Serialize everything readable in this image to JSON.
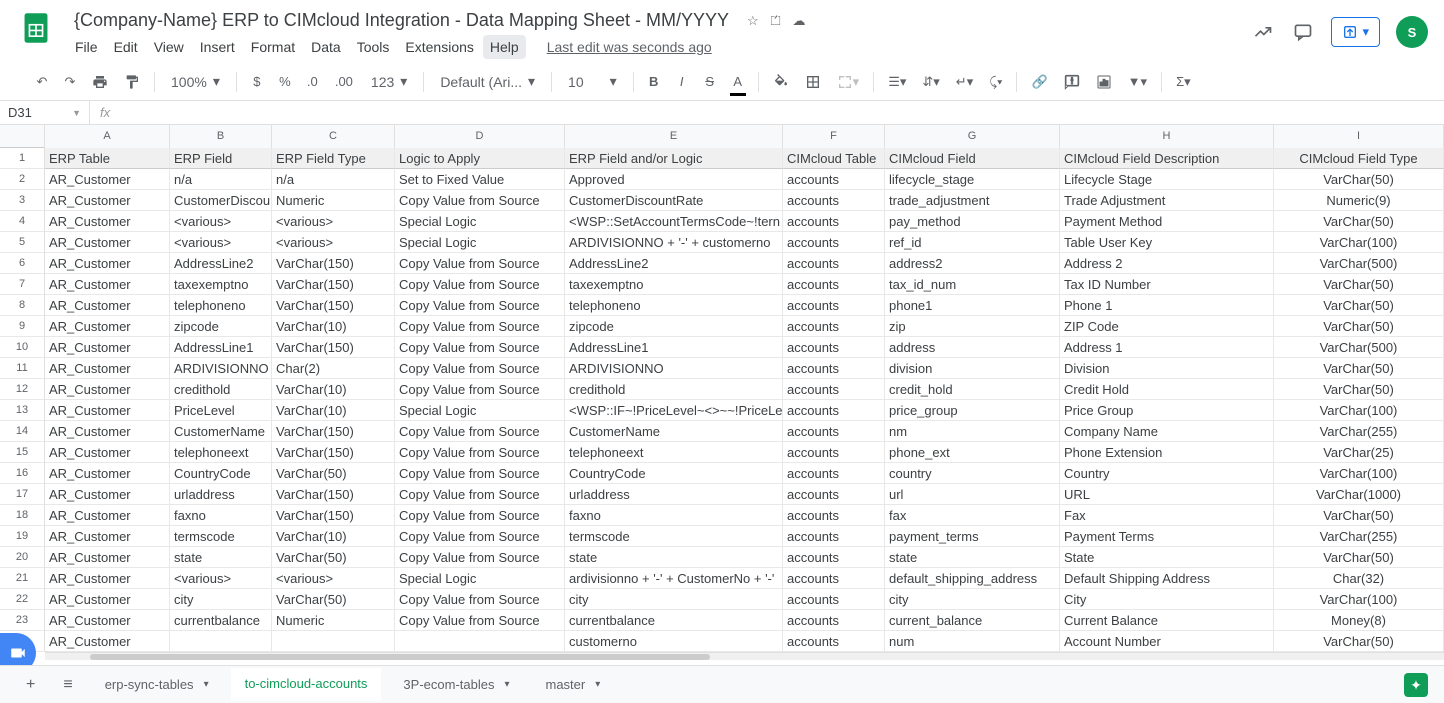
{
  "doc": {
    "title": "{Company-Name} ERP to CIMcloud Integration - Data Mapping Sheet - MM/YYYY",
    "last_edit": "Last edit was seconds ago"
  },
  "menu": {
    "file": "File",
    "edit": "Edit",
    "view": "View",
    "insert": "Insert",
    "format": "Format",
    "data": "Data",
    "tools": "Tools",
    "extensions": "Extensions",
    "help": "Help"
  },
  "toolbar": {
    "zoom": "100%",
    "font": "Default (Ari...",
    "size": "10",
    "more_formats": "123"
  },
  "namebox": "D31",
  "avatar_initial": "S",
  "columns": [
    "A",
    "B",
    "C",
    "D",
    "E",
    "F",
    "G",
    "H",
    "I"
  ],
  "col_widths": [
    "c-A",
    "c-B",
    "c-C",
    "c-D",
    "c-E",
    "c-F",
    "c-G",
    "c-H",
    "c-I"
  ],
  "header_row": [
    "ERP Table",
    "ERP Field",
    "ERP Field Type",
    "Logic to Apply",
    "ERP Field and/or Logic",
    "CIMcloud Table",
    "CIMcloud Field",
    "CIMcloud Field Description",
    "CIMcloud Field Type"
  ],
  "rows": [
    [
      "AR_Customer",
      "n/a",
      "n/a",
      "Set to Fixed Value",
      "Approved",
      "accounts",
      "lifecycle_stage",
      "Lifecycle Stage",
      "VarChar(50)"
    ],
    [
      "AR_Customer",
      "CustomerDiscou",
      "Numeric",
      "Copy Value from Source",
      "CustomerDiscountRate",
      "accounts",
      "trade_adjustment",
      "Trade Adjustment",
      "Numeric(9)"
    ],
    [
      "AR_Customer",
      "<various>",
      "<various>",
      "Special Logic",
      "<WSP::SetAccountTermsCode~!tern",
      "accounts",
      "pay_method",
      "Payment Method",
      "VarChar(50)"
    ],
    [
      "AR_Customer",
      "<various>",
      "<various>",
      "Special Logic",
      "ARDIVISIONNO + '-' + customerno",
      "accounts",
      "ref_id",
      "Table User Key",
      "VarChar(100)"
    ],
    [
      "AR_Customer",
      "AddressLine2",
      "VarChar(150)",
      "Copy Value from Source",
      "AddressLine2",
      "accounts",
      "address2",
      "Address 2",
      "VarChar(500)"
    ],
    [
      "AR_Customer",
      "taxexemptno",
      "VarChar(150)",
      "Copy Value from Source",
      "taxexemptno",
      "accounts",
      "tax_id_num",
      "Tax ID Number",
      "VarChar(50)"
    ],
    [
      "AR_Customer",
      "telephoneno",
      "VarChar(150)",
      "Copy Value from Source",
      "telephoneno",
      "accounts",
      "phone1",
      "Phone 1",
      "VarChar(50)"
    ],
    [
      "AR_Customer",
      "zipcode",
      "VarChar(10)",
      "Copy Value from Source",
      "zipcode",
      "accounts",
      "zip",
      "ZIP Code",
      "VarChar(50)"
    ],
    [
      "AR_Customer",
      "AddressLine1",
      "VarChar(150)",
      "Copy Value from Source",
      "AddressLine1",
      "accounts",
      "address",
      "Address 1",
      "VarChar(500)"
    ],
    [
      "AR_Customer",
      "ARDIVISIONNO",
      "Char(2)",
      "Copy Value from Source",
      "ARDIVISIONNO",
      "accounts",
      "division",
      "Division",
      "VarChar(50)"
    ],
    [
      "AR_Customer",
      "credithold",
      "VarChar(10)",
      "Copy Value from Source",
      "credithold",
      "accounts",
      "credit_hold",
      "Credit Hold",
      "VarChar(50)"
    ],
    [
      "AR_Customer",
      "PriceLevel",
      "VarChar(10)",
      "Special Logic",
      "<WSP::IF~!PriceLevel~<>~~!PriceLe",
      "accounts",
      "price_group",
      "Price Group",
      "VarChar(100)"
    ],
    [
      "AR_Customer",
      "CustomerName",
      "VarChar(150)",
      "Copy Value from Source",
      "CustomerName",
      "accounts",
      "nm",
      "Company Name",
      "VarChar(255)"
    ],
    [
      "AR_Customer",
      "telephoneext",
      "VarChar(150)",
      "Copy Value from Source",
      "telephoneext",
      "accounts",
      "phone_ext",
      "Phone Extension",
      "VarChar(25)"
    ],
    [
      "AR_Customer",
      "CountryCode",
      "VarChar(50)",
      "Copy Value from Source",
      "CountryCode",
      "accounts",
      "country",
      "Country",
      "VarChar(100)"
    ],
    [
      "AR_Customer",
      "urladdress",
      "VarChar(150)",
      "Copy Value from Source",
      "urladdress",
      "accounts",
      "url",
      "URL",
      "VarChar(1000)"
    ],
    [
      "AR_Customer",
      "faxno",
      "VarChar(150)",
      "Copy Value from Source",
      "faxno",
      "accounts",
      "fax",
      "Fax",
      "VarChar(50)"
    ],
    [
      "AR_Customer",
      "termscode",
      "VarChar(10)",
      "Copy Value from Source",
      "termscode",
      "accounts",
      "payment_terms",
      "Payment Terms",
      "VarChar(255)"
    ],
    [
      "AR_Customer",
      "state",
      "VarChar(50)",
      "Copy Value from Source",
      "state",
      "accounts",
      "state",
      "State",
      "VarChar(50)"
    ],
    [
      "AR_Customer",
      "<various>",
      "<various>",
      "Special Logic",
      "ardivisionno + '-' + CustomerNo + '-'",
      "accounts",
      "default_shipping_address",
      "Default Shipping Address",
      "Char(32)"
    ],
    [
      "AR_Customer",
      "city",
      "VarChar(50)",
      "Copy Value from Source",
      "city",
      "accounts",
      "city",
      "City",
      "VarChar(100)"
    ],
    [
      "AR_Customer",
      "currentbalance",
      "Numeric",
      "Copy Value from Source",
      "currentbalance",
      "accounts",
      "current_balance",
      "Current Balance",
      "Money(8)"
    ],
    [
      "AR_Customer",
      "",
      "",
      "",
      "customerno",
      "accounts",
      "num",
      "Account Number",
      "VarChar(50)"
    ]
  ],
  "tabs": {
    "t1": "erp-sync-tables",
    "t2": "to-cimcloud-accounts",
    "t3": "3P-ecom-tables",
    "t4": "master"
  }
}
